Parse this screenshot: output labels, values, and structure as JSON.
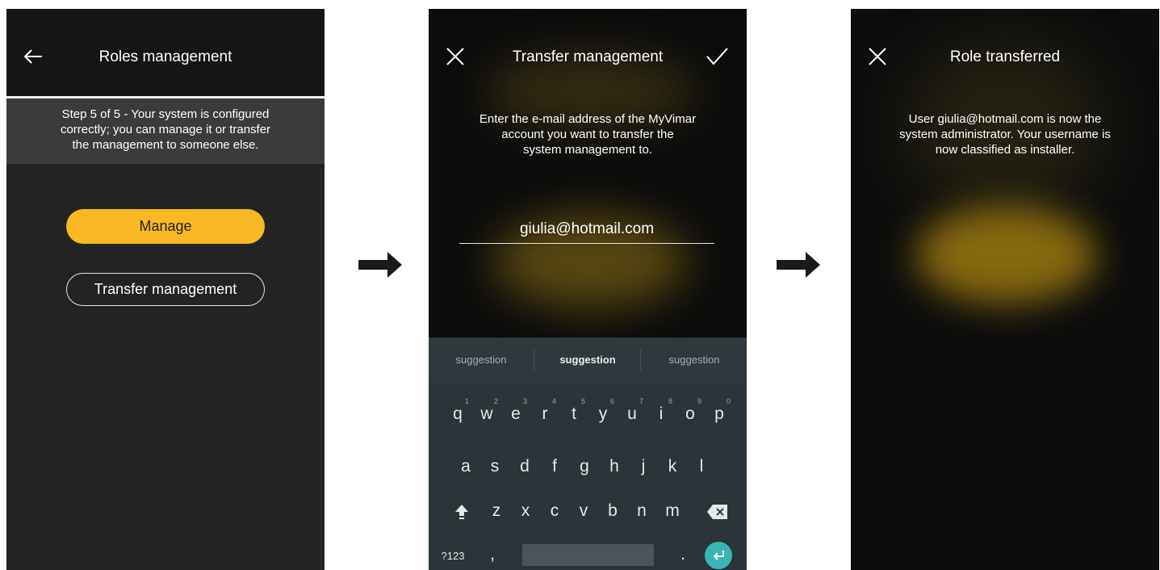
{
  "screen1": {
    "title": "Roles management",
    "step_lines": [
      "Step 5 of 5 -  Your system is configured",
      "correctly; you can manage it or transfer",
      "the management to someone else."
    ],
    "manage_label": "Manage",
    "transfer_label": "Transfer management",
    "back_icon": "arrow-left-icon"
  },
  "screen2": {
    "title": "Transfer management",
    "message_lines": [
      "Enter the e-mail address of the MyVimar",
      "account you want to transfer the",
      "system management to."
    ],
    "email_value": "giulia@hotmail.com",
    "close_icon": "close-icon",
    "confirm_icon": "check-icon",
    "keyboard": {
      "suggestions": [
        "suggestion",
        "suggestion",
        "suggestion"
      ],
      "row1": [
        "q",
        "w",
        "e",
        "r",
        "t",
        "y",
        "u",
        "i",
        "o",
        "p"
      ],
      "row1_digits": [
        "1",
        "2",
        "3",
        "4",
        "5",
        "6",
        "7",
        "8",
        "9",
        "0"
      ],
      "row2": [
        "a",
        "s",
        "d",
        "f",
        "g",
        "h",
        "j",
        "k",
        "l"
      ],
      "row3": [
        "z",
        "x",
        "c",
        "v",
        "b",
        "n",
        "m"
      ],
      "symbols_key": "?123",
      "comma_key": ",",
      "period_key": ".",
      "shift_icon": "shift-icon",
      "backspace_icon": "backspace-icon",
      "enter_icon": "enter-icon"
    }
  },
  "screen3": {
    "title": "Role transferred",
    "message_lines": [
      "User giulia@hotmail.com is now the",
      "system administrator. Your username is",
      "now classified as installer."
    ],
    "close_icon": "close-icon"
  },
  "flow_arrow_icon": "arrow-right-icon",
  "colors": {
    "accent": "#f9b824",
    "keyboard_bg": "#2b3438",
    "enter_key": "#39b6b3"
  }
}
